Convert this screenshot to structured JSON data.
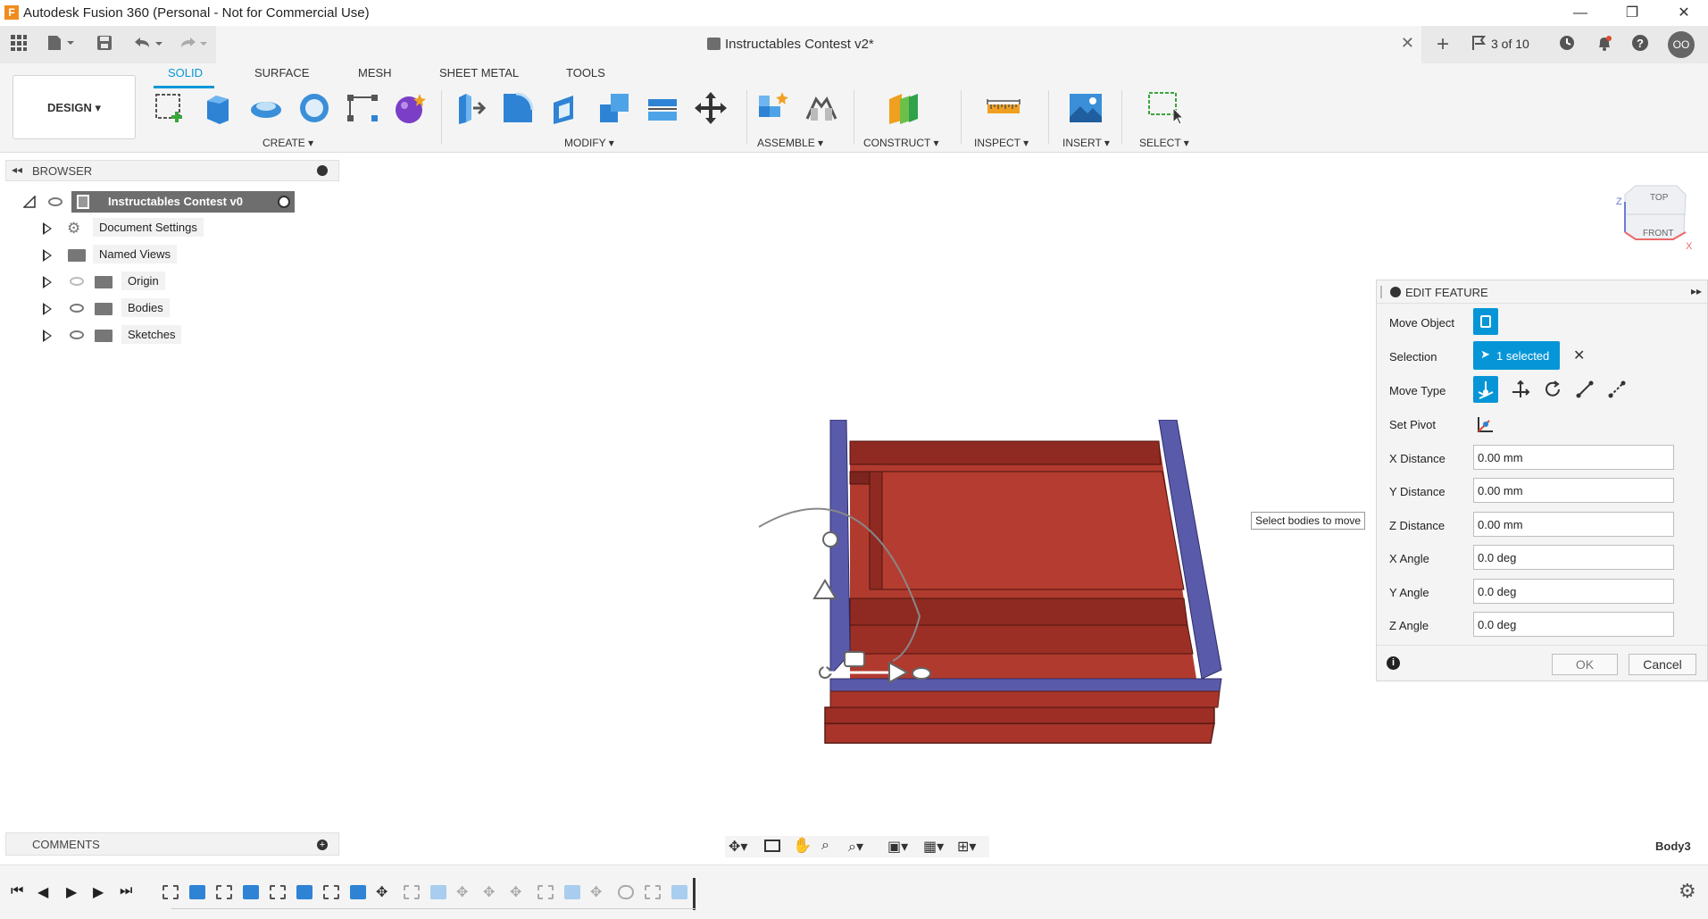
{
  "window": {
    "title": "Autodesk Fusion 360 (Personal - Not for Commercial Use)",
    "logo_letter": "F",
    "minimize": "—",
    "restore": "❐",
    "close": "✕"
  },
  "appbar": {
    "doc_title": "Instructables Contest v2*",
    "doc_close": "✕",
    "new_tab": "+",
    "count": "3 of 10",
    "user_initials": "OO"
  },
  "toolbar": {
    "workspace": "DESIGN",
    "tabs": [
      "SOLID",
      "SURFACE",
      "MESH",
      "SHEET METAL",
      "TOOLS"
    ],
    "groups": [
      "CREATE",
      "MODIFY",
      "ASSEMBLE",
      "CONSTRUCT",
      "INSPECT",
      "INSERT",
      "SELECT"
    ]
  },
  "browser": {
    "header": "BROWSER",
    "root": "Instructables Contest v0",
    "items": [
      {
        "label": "Document Settings",
        "icon": "gear-icon"
      },
      {
        "label": "Named Views",
        "icon": "folder-icon"
      },
      {
        "label": "Origin",
        "icon": "folder-icon"
      },
      {
        "label": "Bodies",
        "icon": "folder-icon"
      },
      {
        "label": "Sketches",
        "icon": "folder-icon"
      }
    ]
  },
  "viewcube": {
    "top": "TOP",
    "front": "FRONT",
    "z": "Z",
    "x": "X"
  },
  "tooltip": "Select bodies to move",
  "edit_feature": {
    "title": "EDIT FEATURE",
    "move_object_label": "Move Object",
    "selection_label": "Selection",
    "selection_value": "1 selected",
    "move_type_label": "Move Type",
    "set_pivot_label": "Set Pivot",
    "fields": [
      {
        "label": "X Distance",
        "value": "0.00 mm"
      },
      {
        "label": "Y Distance",
        "value": "0.00 mm"
      },
      {
        "label": "Z Distance",
        "value": "0.00 mm"
      },
      {
        "label": "X Angle",
        "value": "0.0 deg"
      },
      {
        "label": "Y Angle",
        "value": "0.0 deg"
      },
      {
        "label": "Z Angle",
        "value": "0.0 deg"
      }
    ],
    "ok": "OK",
    "cancel": "Cancel"
  },
  "comments": {
    "header": "COMMENTS"
  },
  "status": {
    "body_name": "Body3"
  },
  "colors": {
    "accent": "#0696d7",
    "body_red": "#a8342a",
    "body_blue": "#5a5aaa"
  }
}
